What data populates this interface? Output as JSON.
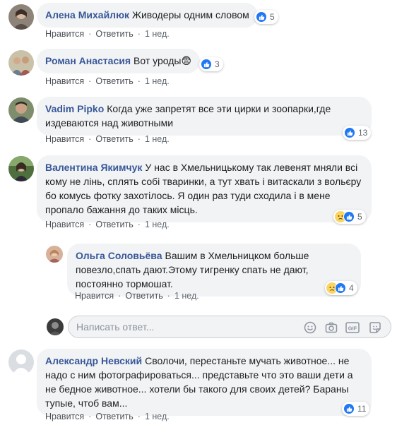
{
  "comments": [
    {
      "author": "Алена Михайлюк",
      "text": "Живодеры одним словом",
      "like_label": "Нравится",
      "reply_label": "Ответить",
      "time": "1 нед.",
      "reaction_count": "5"
    },
    {
      "author": "Роман Анастасия",
      "text": "Вот уроды😨",
      "like_label": "Нравится",
      "reply_label": "Ответить",
      "time": "1 нед.",
      "reaction_count": "3"
    },
    {
      "author": "Vadim Pipko",
      "text": "Когда уже запретят все эти цирки и зоопарки,где издеваются над животными",
      "like_label": "Нравится",
      "reply_label": "Ответить",
      "time": "1 нед.",
      "reaction_count": "13"
    },
    {
      "author": "Валентина Якимчук",
      "text": "У нас в Хмельницькому так левенят мняли всі кому не лінь, сплять собі тваринки, а тут хвать і витаскали з вольєру бо комусь фотку захотілось. Я один раз туди сходила і в мене пропало бажання до таких місць.",
      "like_label": "Нравится",
      "reply_label": "Ответить",
      "time": "1 нед.",
      "reaction_count": "5"
    },
    {
      "author": "Ольга Соловьёва",
      "text": "Вашим в Хмельницком больше повезло,спать дают.Этому тигренку спать не дают, постоянно тормошат.",
      "like_label": "Нравится",
      "reply_label": "Ответить",
      "time": "1 нед.",
      "reaction_count": "4"
    },
    {
      "author": "Александр Невский",
      "text": "Сволочи, перестаньте мучать животное... не надо с ним фотографироваться... представьте что это ваши дети а не бедное животное... хотели бы такого для своих детей? Бараны тупые, чтоб вам...",
      "like_label": "Нравится",
      "reply_label": "Ответить",
      "time": "1 нед.",
      "reaction_count": "11"
    }
  ],
  "reply_box": {
    "placeholder": "Написать ответ...",
    "tools": [
      "emoji-icon",
      "camera-icon",
      "gif-icon",
      "sticker-icon"
    ]
  },
  "colors": {
    "author": "#385898",
    "bubble": "#f2f3f5",
    "like_blue": "#2078f4",
    "meta": "#606770"
  }
}
